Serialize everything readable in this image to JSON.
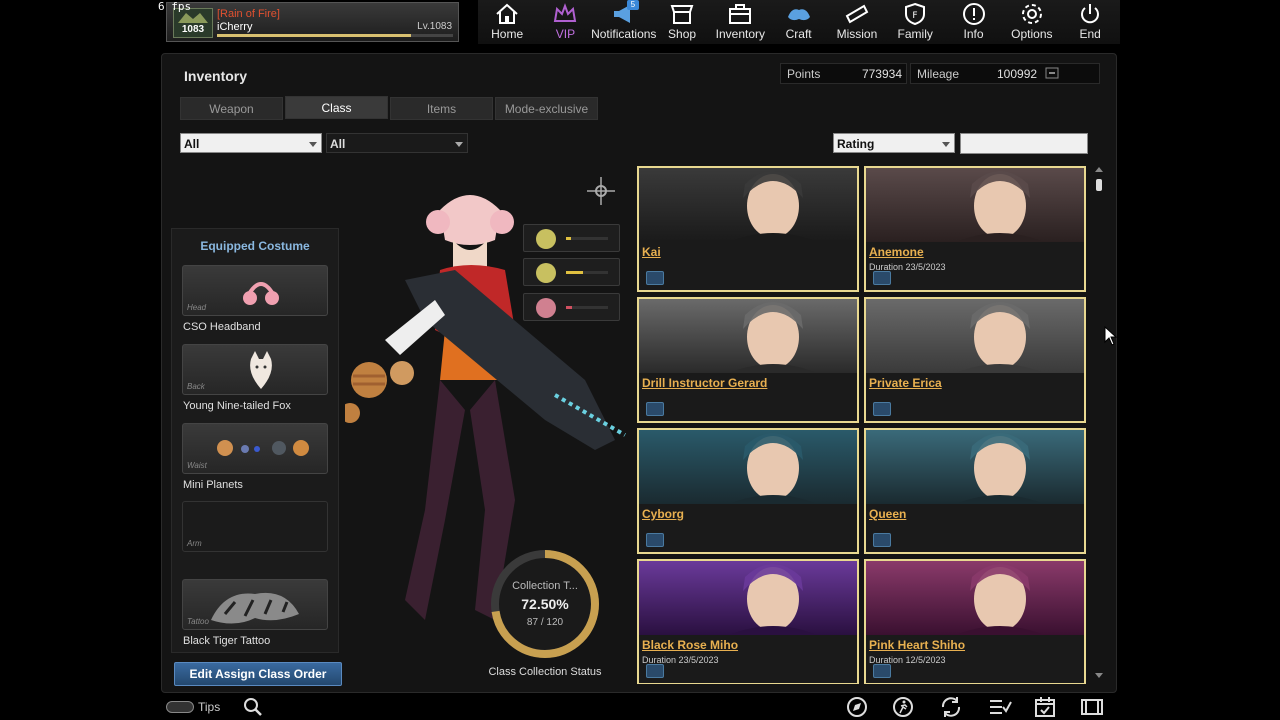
{
  "fps": "6 fps",
  "player": {
    "level_badge": "1083",
    "clan": "[Rain of Fire]",
    "name": "iCherry",
    "level": "Lv.1083",
    "xp_fraction": 0.82
  },
  "nav": {
    "items": [
      {
        "label": "Home",
        "icon": "home-icon"
      },
      {
        "label": "VIP",
        "icon": "crown-icon"
      },
      {
        "label": "Notifications",
        "icon": "megaphone-icon",
        "badge": "5"
      },
      {
        "label": "Shop",
        "icon": "shop-icon"
      },
      {
        "label": "Inventory",
        "icon": "bag-icon"
      },
      {
        "label": "Craft",
        "icon": "craft-icon"
      },
      {
        "label": "Mission",
        "icon": "mission-icon"
      },
      {
        "label": "Family",
        "icon": "shield-icon"
      },
      {
        "label": "Info",
        "icon": "info-icon"
      },
      {
        "label": "Options",
        "icon": "gear-icon"
      },
      {
        "label": "End",
        "icon": "power-icon"
      }
    ]
  },
  "inventory": {
    "title": "Inventory",
    "points_label": "Points",
    "points_value": "773934",
    "mileage_label": "Mileage",
    "mileage_value": "100992",
    "tabs": [
      "Weapon",
      "Class",
      "Items",
      "Mode-exclusive"
    ],
    "active_tab": "Class",
    "filter1": "All",
    "filter2": "All",
    "sort": "Rating"
  },
  "costume": {
    "title": "Equipped Costume",
    "slots": [
      {
        "tag": "Head",
        "name": "CSO Headband"
      },
      {
        "tag": "Back",
        "name": "Young Nine-tailed Fox"
      },
      {
        "tag": "Waist",
        "name": "Mini Planets"
      },
      {
        "tag": "Arm",
        "name": ""
      },
      {
        "tag": "Tattoo",
        "name": "Black Tiger Tattoo"
      }
    ],
    "edit_button": "Edit Assign Class Order"
  },
  "collection": {
    "title": "Collection T...",
    "percent": "72.50%",
    "count": "87 / 120",
    "fraction": 0.725,
    "label": "Class Collection Status"
  },
  "classes": [
    {
      "name": "Kai",
      "duration": "",
      "theme": [
        "#3a3a3a",
        "#1a1a1a"
      ]
    },
    {
      "name": "Anemone",
      "duration": "Duration 23/5/2023",
      "theme": [
        "#5a4a4a",
        "#2a2020"
      ]
    },
    {
      "name": "Drill Instructor Gerard",
      "duration": "",
      "theme": [
        "#6a6a6a",
        "#2a2a2a"
      ]
    },
    {
      "name": "Private Erica",
      "duration": "",
      "theme": [
        "#6a6a6a",
        "#3a3a3a"
      ]
    },
    {
      "name": "Cyborg",
      "duration": "",
      "theme": [
        "#2a5a6a",
        "#1a2a30"
      ]
    },
    {
      "name": "Queen",
      "duration": "",
      "theme": [
        "#3a6a7a",
        "#1a2a30"
      ]
    },
    {
      "name": "Black Rose Miho",
      "duration": "Duration 23/5/2023",
      "theme": [
        "#6a3a9a",
        "#2a1040"
      ]
    },
    {
      "name": "Pink Heart Shiho",
      "duration": "Duration 12/5/2023",
      "theme": [
        "#8a3a6a",
        "#3a1030"
      ]
    }
  ],
  "bottom": {
    "tips": "Tips",
    "icons": [
      "compass-icon",
      "runner-icon",
      "refresh-icon",
      "checklist-icon",
      "calendar-icon",
      "film-icon"
    ]
  },
  "colors": {
    "accent_gold": "#e8d890",
    "class_name": "#e8b050",
    "clan_red": "#e05030",
    "vip_purple": "#c070e0"
  }
}
